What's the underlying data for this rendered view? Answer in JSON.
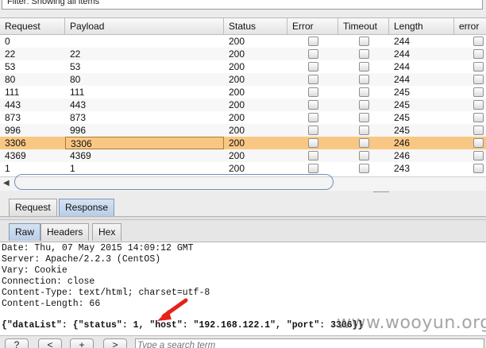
{
  "filter": {
    "text": "Filter: Showing all items"
  },
  "table": {
    "columns": [
      "Request",
      "Payload",
      "Status",
      "Error",
      "Timeout",
      "Length",
      "error"
    ],
    "rows": [
      {
        "request": "0",
        "payload": "",
        "status": "200",
        "length": "244",
        "selected": false
      },
      {
        "request": "22",
        "payload": "22",
        "status": "200",
        "length": "244",
        "selected": false
      },
      {
        "request": "53",
        "payload": "53",
        "status": "200",
        "length": "244",
        "selected": false
      },
      {
        "request": "80",
        "payload": "80",
        "status": "200",
        "length": "244",
        "selected": false
      },
      {
        "request": "111",
        "payload": "111",
        "status": "200",
        "length": "245",
        "selected": false
      },
      {
        "request": "443",
        "payload": "443",
        "status": "200",
        "length": "245",
        "selected": false
      },
      {
        "request": "873",
        "payload": "873",
        "status": "200",
        "length": "245",
        "selected": false
      },
      {
        "request": "996",
        "payload": "996",
        "status": "200",
        "length": "245",
        "selected": false
      },
      {
        "request": "3306",
        "payload": "3306",
        "status": "200",
        "length": "246",
        "selected": true
      },
      {
        "request": "4369",
        "payload": "4369",
        "status": "200",
        "length": "246",
        "selected": false
      },
      {
        "request": "1",
        "payload": "1",
        "status": "200",
        "length": "243",
        "selected": false
      }
    ]
  },
  "tabs": {
    "request": "Request",
    "response": "Response"
  },
  "view_tabs": {
    "raw": "Raw",
    "headers": "Headers",
    "hex": "Hex"
  },
  "response": {
    "lines": [
      "Date: Thu, 07 May 2015 14:09:12 GMT",
      "Server: Apache/2.2.3 (CentOS)",
      "Vary: Cookie",
      "Connection: close",
      "Content-Type: text/html; charset=utf-8",
      "Content-Length: 66"
    ],
    "body": "{\"dataList\": {\"status\": 1, \"host\": \"192.168.122.1\", \"port\": 3306}}"
  },
  "watermark": "www.wooyun.org",
  "bottom": {
    "help": "?",
    "prev": "<",
    "add": "+",
    "next": ">",
    "search_placeholder": "Type a search term"
  },
  "colors": {
    "selected_row": "#f9c784",
    "arrow": "#e8201a"
  }
}
